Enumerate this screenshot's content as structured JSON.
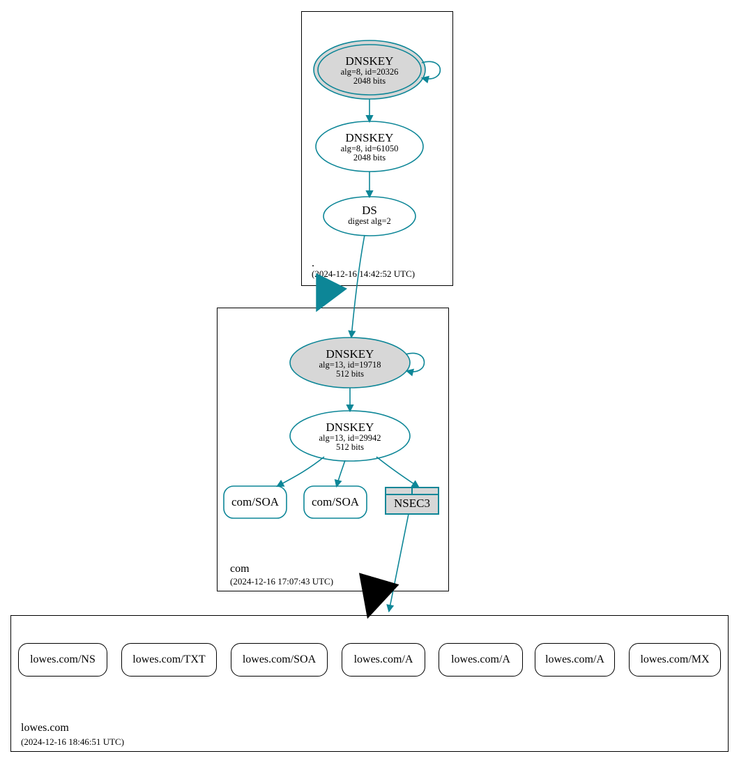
{
  "colors": {
    "teal": "#0d8697",
    "grey_fill": "#d7d7d7",
    "black": "#000000",
    "white": "#ffffff"
  },
  "zones": {
    "root": {
      "name": ".",
      "timestamp": "(2024-12-16 14:42:52 UTC)",
      "nodes": {
        "ksk": {
          "title": "DNSKEY",
          "line2": "alg=8, id=20326",
          "line3": "2048 bits"
        },
        "zsk": {
          "title": "DNSKEY",
          "line2": "alg=8, id=61050",
          "line3": "2048 bits"
        },
        "ds": {
          "title": "DS",
          "line2": "digest alg=2"
        }
      }
    },
    "com": {
      "name": "com",
      "timestamp": "(2024-12-16 17:07:43 UTC)",
      "nodes": {
        "ksk": {
          "title": "DNSKEY",
          "line2": "alg=13, id=19718",
          "line3": "512 bits"
        },
        "zsk": {
          "title": "DNSKEY",
          "line2": "alg=13, id=29942",
          "line3": "512 bits"
        },
        "soa1": {
          "label": "com/SOA"
        },
        "soa2": {
          "label": "com/SOA"
        },
        "nsec3": {
          "label": "NSEC3"
        }
      }
    },
    "lowes": {
      "name": "lowes.com",
      "timestamp": "(2024-12-16 18:46:51 UTC)",
      "rrsets": [
        "lowes.com/NS",
        "lowes.com/TXT",
        "lowes.com/SOA",
        "lowes.com/A",
        "lowes.com/A",
        "lowes.com/A",
        "lowes.com/MX"
      ]
    }
  }
}
